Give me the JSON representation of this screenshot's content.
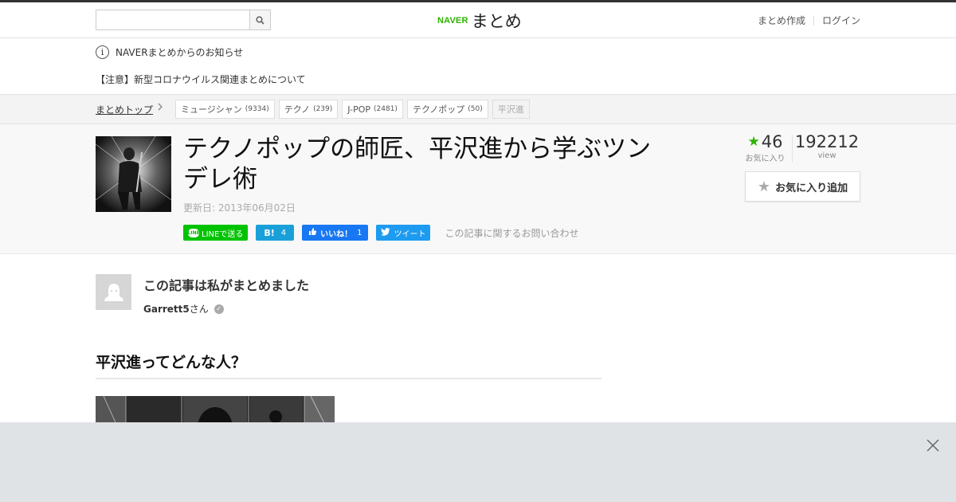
{
  "header": {
    "search": {
      "value": "",
      "placeholder": ""
    },
    "logo": {
      "brand": "NAVER",
      "service": "まとめ"
    },
    "links": {
      "create": "まとめ作成",
      "login": "ログイン"
    }
  },
  "notices": {
    "title": "NAVERまとめからのお知らせ",
    "item": "【注意】新型コロナウイルス関連まとめについて"
  },
  "breadcrumb": {
    "top": "まとめトップ",
    "tags": [
      {
        "label": "ミュージシャン",
        "count": "(9334)"
      },
      {
        "label": "テクノ",
        "count": "(239)"
      },
      {
        "label": "J-POP",
        "count": "(2481)"
      },
      {
        "label": "テクノポップ",
        "count": "(50)"
      }
    ],
    "current": "平沢進"
  },
  "article": {
    "title": "テクノポップの師匠、平沢進から学ぶツンデレ術",
    "updated": "更新日: 2013年06月02日",
    "share": {
      "line": "LINEで送る",
      "hatena_label": "B!",
      "hatena_count": "4",
      "fb_label": "いいね！",
      "fb_count": "1",
      "tweet": "ツイート"
    },
    "inquiry": "この記事に関するお問い合わせ",
    "stats": {
      "favorites": "46",
      "favorites_label": "お気に入り",
      "views": "192212",
      "views_label": "view"
    },
    "fav_button": "お気に入り追加"
  },
  "author": {
    "heading": "この記事は私がまとめました",
    "name": "Garrett5",
    "suffix": "さん"
  },
  "section": {
    "heading": "平沢進ってどんな人？"
  },
  "colors": {
    "naver_green": "#2db400",
    "line": "#00c300",
    "hatena": "#1aa0d9",
    "facebook": "#1877f2",
    "twitter": "#1d9bf0"
  },
  "icons": [
    "search-icon",
    "info-icon",
    "chevron-right-icon",
    "star-icon",
    "verified-icon",
    "close-icon"
  ]
}
